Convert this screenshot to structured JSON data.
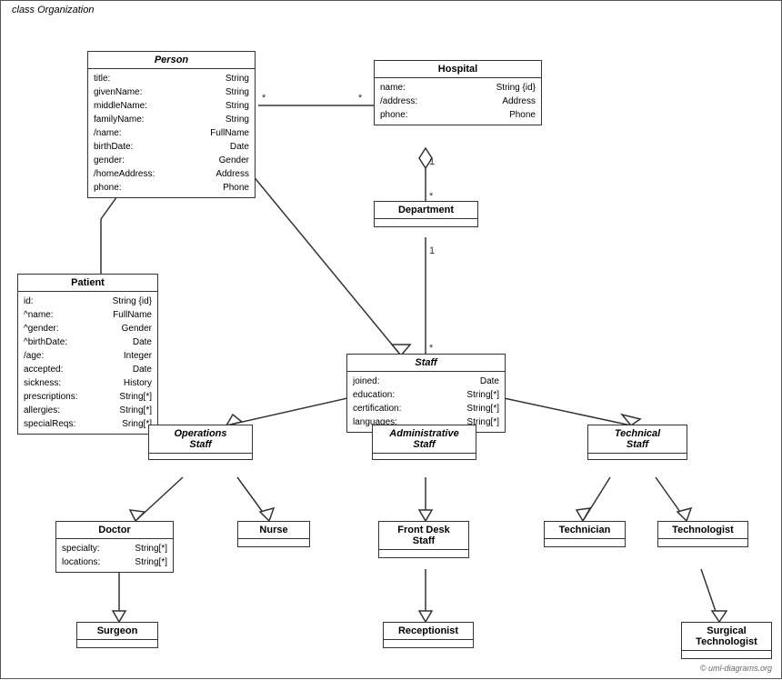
{
  "diagram": {
    "title": "class Organization",
    "classes": {
      "person": {
        "name": "Person",
        "italic": true,
        "attributes": [
          {
            "name": "title:",
            "type": "String"
          },
          {
            "name": "givenName:",
            "type": "String"
          },
          {
            "name": "middleName:",
            "type": "String"
          },
          {
            "name": "familyName:",
            "type": "String"
          },
          {
            "name": "/name:",
            "type": "FullName"
          },
          {
            "name": "birthDate:",
            "type": "Date"
          },
          {
            "name": "gender:",
            "type": "Gender"
          },
          {
            "name": "/homeAddress:",
            "type": "Address"
          },
          {
            "name": "phone:",
            "type": "Phone"
          }
        ]
      },
      "hospital": {
        "name": "Hospital",
        "italic": false,
        "attributes": [
          {
            "name": "name:",
            "type": "String {id}"
          },
          {
            "name": "/address:",
            "type": "Address"
          },
          {
            "name": "phone:",
            "type": "Phone"
          }
        ]
      },
      "patient": {
        "name": "Patient",
        "italic": false,
        "attributes": [
          {
            "name": "id:",
            "type": "String {id}"
          },
          {
            "name": "^name:",
            "type": "FullName"
          },
          {
            "name": "^gender:",
            "type": "Gender"
          },
          {
            "name": "^birthDate:",
            "type": "Date"
          },
          {
            "name": "/age:",
            "type": "Integer"
          },
          {
            "name": "accepted:",
            "type": "Date"
          },
          {
            "name": "sickness:",
            "type": "History"
          },
          {
            "name": "prescriptions:",
            "type": "String[*]"
          },
          {
            "name": "allergies:",
            "type": "String[*]"
          },
          {
            "name": "specialReqs:",
            "type": "Sring[*]"
          }
        ]
      },
      "department": {
        "name": "Department",
        "italic": false,
        "attributes": []
      },
      "staff": {
        "name": "Staff",
        "italic": true,
        "attributes": [
          {
            "name": "joined:",
            "type": "Date"
          },
          {
            "name": "education:",
            "type": "String[*]"
          },
          {
            "name": "certification:",
            "type": "String[*]"
          },
          {
            "name": "languages:",
            "type": "String[*]"
          }
        ]
      },
      "operations_staff": {
        "name": "Operations Staff",
        "italic": true
      },
      "administrative_staff": {
        "name": "Administrative Staff",
        "italic": true
      },
      "technical_staff": {
        "name": "Technical Staff",
        "italic": true
      },
      "doctor": {
        "name": "Doctor",
        "italic": false,
        "attributes": [
          {
            "name": "specialty:",
            "type": "String[*]"
          },
          {
            "name": "locations:",
            "type": "String[*]"
          }
        ]
      },
      "nurse": {
        "name": "Nurse",
        "italic": false,
        "attributes": []
      },
      "front_desk_staff": {
        "name": "Front Desk Staff",
        "italic": false,
        "attributes": []
      },
      "technician": {
        "name": "Technician",
        "italic": false,
        "attributes": []
      },
      "technologist": {
        "name": "Technologist",
        "italic": false,
        "attributes": []
      },
      "surgeon": {
        "name": "Surgeon",
        "italic": false,
        "attributes": []
      },
      "receptionist": {
        "name": "Receptionist",
        "italic": false,
        "attributes": []
      },
      "surgical_technologist": {
        "name": "Surgical Technologist",
        "italic": false,
        "attributes": []
      }
    },
    "copyright": "© uml-diagrams.org"
  }
}
